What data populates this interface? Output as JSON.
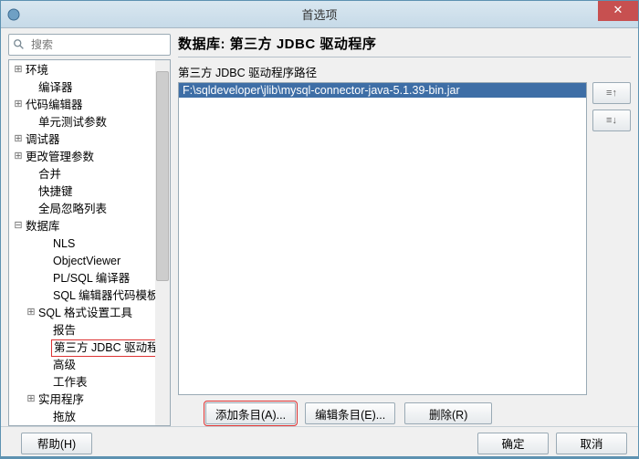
{
  "window": {
    "title": "首选项"
  },
  "search": {
    "placeholder": "搜索"
  },
  "tree": {
    "items": [
      {
        "label": "环境",
        "depth": 0,
        "tw": "⊞"
      },
      {
        "label": "编译器",
        "depth": 1,
        "tw": ""
      },
      {
        "label": "代码编辑器",
        "depth": 0,
        "tw": "⊞"
      },
      {
        "label": "单元测试参数",
        "depth": 1,
        "tw": ""
      },
      {
        "label": "调试器",
        "depth": 0,
        "tw": "⊞"
      },
      {
        "label": "更改管理参数",
        "depth": 0,
        "tw": "⊞"
      },
      {
        "label": "合并",
        "depth": 1,
        "tw": ""
      },
      {
        "label": "快捷键",
        "depth": 1,
        "tw": ""
      },
      {
        "label": "全局忽略列表",
        "depth": 1,
        "tw": ""
      },
      {
        "label": "数据库",
        "depth": 0,
        "tw": "⊟"
      },
      {
        "label": "NLS",
        "depth": 2,
        "tw": ""
      },
      {
        "label": "ObjectViewer",
        "depth": 2,
        "tw": ""
      },
      {
        "label": "PL/SQL 编译器",
        "depth": 2,
        "tw": ""
      },
      {
        "label": "SQL 编辑器代码模板",
        "depth": 2,
        "tw": ""
      },
      {
        "label": "SQL 格式设置工具",
        "depth": 1,
        "tw": "⊞"
      },
      {
        "label": "报告",
        "depth": 2,
        "tw": ""
      },
      {
        "label": "第三方 JDBC 驱动程",
        "depth": 2,
        "tw": "",
        "selected": true
      },
      {
        "label": "高级",
        "depth": 2,
        "tw": ""
      },
      {
        "label": "工作表",
        "depth": 2,
        "tw": ""
      },
      {
        "label": "实用程序",
        "depth": 1,
        "tw": "⊞"
      },
      {
        "label": "拖放",
        "depth": 2,
        "tw": ""
      }
    ]
  },
  "panel": {
    "title": "数据库:  第三方 JDBC 驱动程序",
    "subtitle": "第三方 JDBC 驱动程序路径",
    "list": [
      "F:\\sqldeveloper\\jlib\\mysql-connector-java-5.1.39-bin.jar"
    ],
    "moveUp": "≡↑",
    "moveDown": "≡↓",
    "addEntry": "添加条目(A)...",
    "editEntry": "编辑条目(E)...",
    "deleteEntry": "删除(R)"
  },
  "footer": {
    "help": "帮助(H)",
    "ok": "确定",
    "cancel": "取消"
  }
}
